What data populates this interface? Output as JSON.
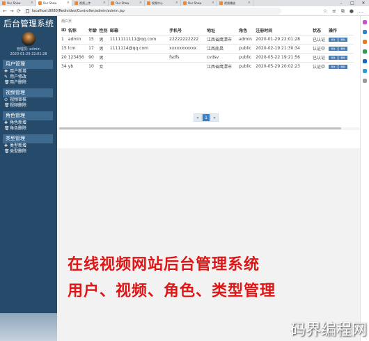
{
  "browser": {
    "tabs": [
      "Our Show",
      "Our Show",
      "视频上传",
      "Our Show",
      "视频中心",
      "Our Show",
      "视频播放"
    ],
    "active_tab": 1,
    "url": "localhost:8080/Redivideo/Controller/admin/admin.jsp"
  },
  "sidebar": {
    "title": "后台管理系统",
    "user_line1": "管理员: admin",
    "user_line2": "2020-01-29 22:01:28",
    "groups": [
      {
        "title": "用户管理",
        "items": [
          {
            "icon": "plus",
            "label": "用户新增"
          },
          {
            "icon": "pencil",
            "label": "用户修改"
          },
          {
            "icon": "trash",
            "label": "用户删除"
          }
        ]
      },
      {
        "title": "视频管理",
        "items": [
          {
            "icon": "check-circle",
            "label": "视频审核"
          },
          {
            "icon": "trash",
            "label": "视频删除"
          }
        ]
      },
      {
        "title": "角色管理",
        "items": [
          {
            "icon": "plus",
            "label": "角色新增"
          },
          {
            "icon": "trash",
            "label": "角色删除"
          }
        ]
      },
      {
        "title": "类型管理",
        "items": [
          {
            "icon": "plus",
            "label": "类型新增"
          },
          {
            "icon": "trash",
            "label": "类型删除"
          }
        ]
      }
    ]
  },
  "main": {
    "breadcrumb": "用户页",
    "columns": [
      "ID",
      "名称",
      "年龄",
      "性别",
      "邮箱",
      "手机号",
      "地址",
      "角色",
      "注册时间",
      "状态",
      "操作"
    ],
    "rows": [
      [
        "1",
        "admin",
        "15",
        "男",
        "1111111111@qq.com",
        "22222222222",
        "江西省鹰潭市",
        "admin",
        "2020-01-29 22:01:28",
        "已认证"
      ],
      [
        "15",
        "lcm",
        "17",
        "男",
        "1111114@qq.com",
        "xxxxxxxxxxx",
        "江西南昌",
        "public",
        "2020-02-19 21:30:34",
        "认证中"
      ],
      [
        "20",
        "123456",
        "90",
        "男",
        "",
        "fsdfs",
        "cvdsv",
        "public",
        "2020-05-22 19:21:56",
        "已认证"
      ],
      [
        "34",
        "yb",
        "10",
        "女",
        "",
        "",
        "江西省鹰潭市",
        "public",
        "2020-05-29 20:02:23",
        "认证中"
      ]
    ],
    "action_labels": [
      "修改",
      "删除"
    ],
    "pager": {
      "prev": "«",
      "current": "1",
      "next": "»"
    }
  },
  "caption": {
    "line1": "在线视频网站后台管理系统",
    "line2": "用户、视频、角色、类型管理"
  },
  "watermark": "码界编程网",
  "colors": {
    "sidebar": "#264a6a",
    "caption": "#e01515",
    "accent": "#3b7fc4"
  }
}
